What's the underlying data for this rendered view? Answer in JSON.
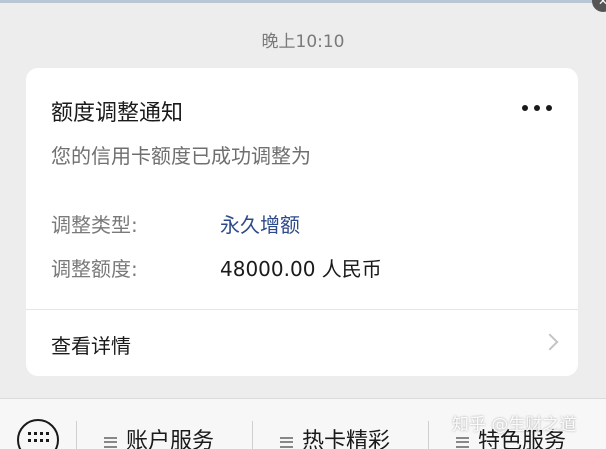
{
  "timestamp": "晚上10:10",
  "card": {
    "title": "额度调整通知",
    "subtitle": "您的信用卡额度已成功调整为",
    "adjust_type": {
      "label": "调整类型:",
      "value": "永久增额"
    },
    "adjust_amount": {
      "label": "调整额度:",
      "value": "48000.00 人民币"
    },
    "details_label": "查看详情"
  },
  "bottom_menu": {
    "items": [
      "账户服务",
      "热卡精彩",
      "特色服务"
    ]
  },
  "watermark": "知乎 @生财之道",
  "colors": {
    "background": "#ededed",
    "card": "#ffffff",
    "value_link": "#2d4a8a"
  },
  "icons": [
    "close-icon",
    "more-icon",
    "chevron-right-icon",
    "keyboard-icon",
    "menu-icon"
  ]
}
